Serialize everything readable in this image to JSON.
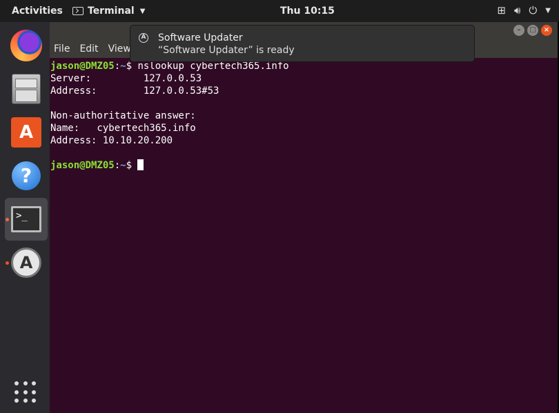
{
  "topbar": {
    "activities": "Activities",
    "app_name": "Terminal",
    "clock": "Thu 10:15",
    "tray_icons": [
      "network-icon",
      "volume-icon",
      "power-icon"
    ]
  },
  "dock": {
    "items": [
      "firefox-icon",
      "files-icon",
      "software-store-icon",
      "help-icon",
      "terminal-icon",
      "software-updater-icon"
    ],
    "store_glyph": "A",
    "help_glyph": "?",
    "terminal_glyph": ">_",
    "updater_glyph": "A"
  },
  "window": {
    "menu": [
      "File",
      "Edit",
      "View"
    ],
    "controls": [
      "minimize",
      "maximize",
      "close"
    ]
  },
  "terminal": {
    "user_host": "jason@DMZ05",
    "sep": ":",
    "path": "~",
    "prompt_char": "$ ",
    "command": "nslookup cybertech365.info",
    "output": [
      "Server:         127.0.0.53",
      "Address:        127.0.0.53#53",
      "",
      "Non-authoritative answer:",
      "Name:   cybertech365.info",
      "Address: 10.10.20.200",
      ""
    ]
  },
  "notification": {
    "title": "Software Updater",
    "body": "“Software Updater” is ready"
  },
  "colors": {
    "terminal_bg": "#300a24",
    "prompt_user": "#8ae234",
    "prompt_path": "#729fcf",
    "accent": "#e95420"
  }
}
